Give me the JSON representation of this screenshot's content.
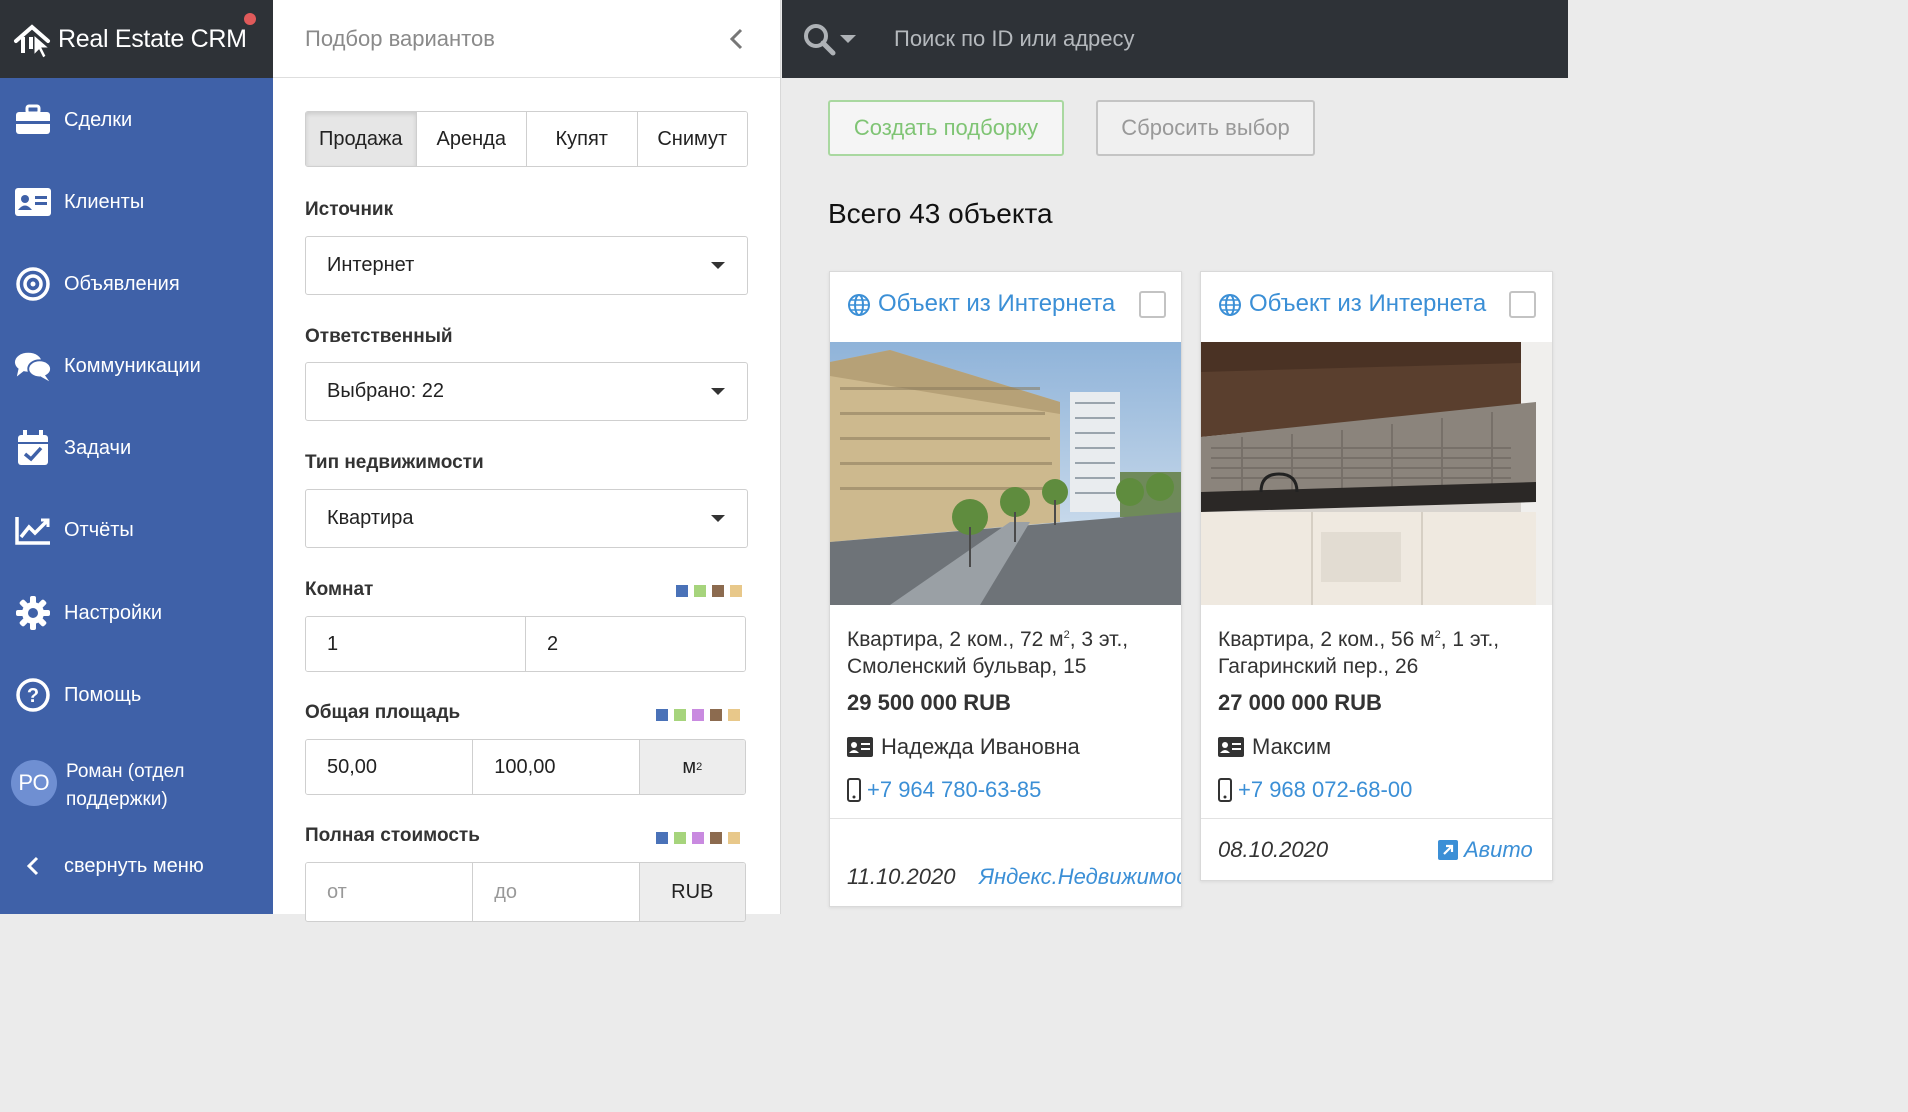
{
  "brand": {
    "name": "Real Estate CRM"
  },
  "nav": {
    "items": [
      {
        "label": "Сделки",
        "icon": "briefcase-icon"
      },
      {
        "label": "Клиенты",
        "icon": "contact-card-icon"
      },
      {
        "label": "Объявления",
        "icon": "target-icon"
      },
      {
        "label": "Коммуникации",
        "icon": "chat-bubbles-icon"
      },
      {
        "label": "Задачи",
        "icon": "calendar-check-icon"
      },
      {
        "label": "Отчёты",
        "icon": "chart-line-icon"
      },
      {
        "label": "Настройки",
        "icon": "gear-icon"
      },
      {
        "label": "Помощь",
        "icon": "help-circle-icon"
      }
    ],
    "user": {
      "initials": "РО",
      "name": "Роман (отдел поддержки)"
    },
    "collapse_label": "свернуть меню"
  },
  "filter": {
    "title": "Подбор вариантов",
    "deal_types": [
      "Продажа",
      "Аренда",
      "Купят",
      "Снимут"
    ],
    "active_deal_type": "Продажа",
    "source": {
      "label": "Источник",
      "value": "Интернет"
    },
    "responsible": {
      "label": "Ответственный",
      "value": "Выбрано: 22"
    },
    "property_type": {
      "label": "Тип недвижимости",
      "value": "Квартира"
    },
    "rooms": {
      "label": "Комнат",
      "from": "1",
      "to": "2",
      "swatches": [
        "#4a72b8",
        "#a6d47c",
        "#8c6b4f",
        "#e8c88a"
      ]
    },
    "area": {
      "label": "Общая площадь",
      "from": "50,00",
      "to": "100,00",
      "unit": "м",
      "unit_sup": "2",
      "swatches": [
        "#4a72b8",
        "#a6d47c",
        "#c98ae0",
        "#8c6b4f",
        "#e8c88a"
      ]
    },
    "price": {
      "label": "Полная стоимость",
      "from_placeholder": "от",
      "to_placeholder": "до",
      "currency": "RUB",
      "swatches": [
        "#4a72b8",
        "#a6d47c",
        "#c98ae0",
        "#8c6b4f",
        "#e8c88a"
      ]
    }
  },
  "search": {
    "placeholder": "Поиск по ID или адресу"
  },
  "actions": {
    "create_label": "Создать подборку",
    "reset_label": "Сбросить выбор"
  },
  "results": {
    "total_label": "Всего 43 объекта",
    "cards": [
      {
        "title": "Объект из Интернета",
        "desc_before_sup": "Квартира, 2 ком., 72 м",
        "desc_sup": "2",
        "desc_after_sup": ", 3 эт., Смоленский бульвар, 15",
        "price": "29 500 000 RUB",
        "agent": "Надежда Ивановна",
        "phone": "+7 964 780-63-85",
        "date": "11.10.2020",
        "source": "Яндекс.Недвижимость"
      },
      {
        "title": "Объект из Интернета",
        "desc_before_sup": "Квартира, 2 ком., 56 м",
        "desc_sup": "2",
        "desc_after_sup": ", 1 эт., Гагаринский пер., 26",
        "price": "27 000 000 RUB",
        "agent": "Максим",
        "phone": "+7 968 072-68-00",
        "date": "08.10.2020",
        "source": "Авито"
      }
    ]
  },
  "colors": {
    "nav_bg": "#3f61a8",
    "topbar_bg": "#2e3237",
    "link": "#3b8fd6",
    "create_green": "#7fc474"
  }
}
